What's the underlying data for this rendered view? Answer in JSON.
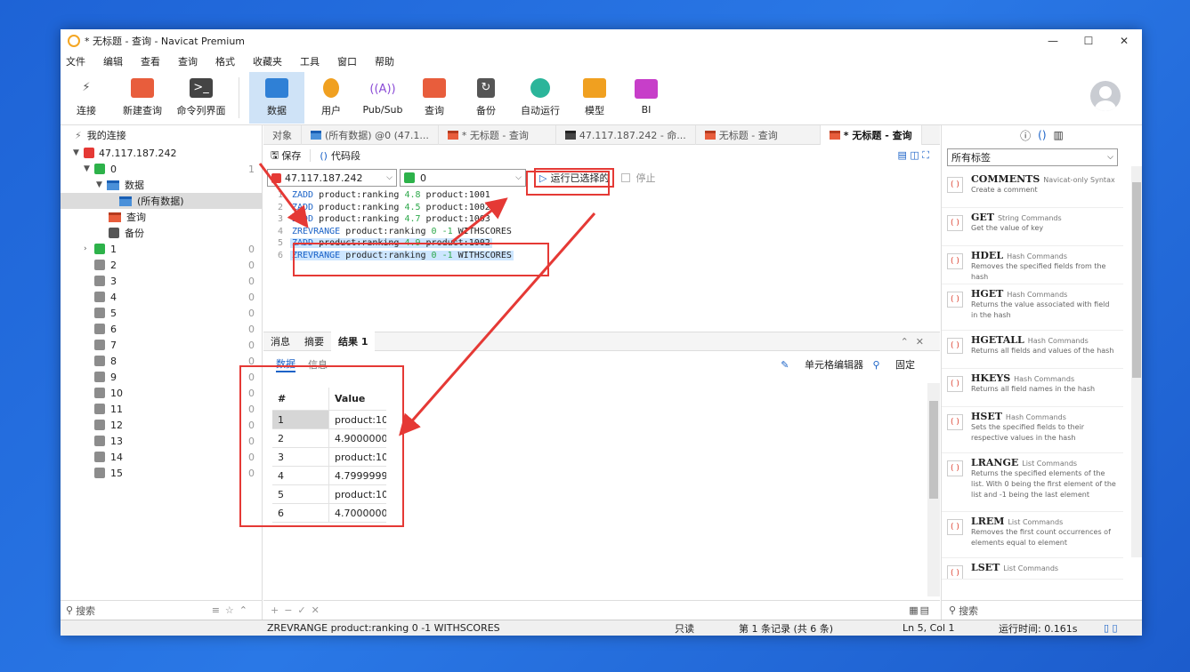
{
  "window": {
    "title": "* 无标题 - 查询 - Navicat Premium",
    "min": "—",
    "max": "☐",
    "close": "✕"
  },
  "menu": [
    "文件",
    "编辑",
    "查看",
    "查询",
    "格式",
    "收藏夹",
    "工具",
    "窗口",
    "帮助"
  ],
  "toolbar": {
    "connect": "连接",
    "new_query": "新建查询",
    "cmd": "命令列界面",
    "data": "数据",
    "user": "用户",
    "pubsub": "Pub/Sub",
    "query": "查询",
    "backup": "备份",
    "auto": "自动运行",
    "model": "模型",
    "bi": "BI"
  },
  "tree": {
    "header": "我的连接",
    "server": "47.117.187.242",
    "db0": "0",
    "db0_count": "1",
    "data_node": "数据",
    "all_data": "(所有数据)",
    "query_node": "查询",
    "backup_node": "备份",
    "dbs": [
      {
        "name": "1",
        "count": "0"
      },
      {
        "name": "2",
        "count": "0"
      },
      {
        "name": "3",
        "count": "0"
      },
      {
        "name": "4",
        "count": "0"
      },
      {
        "name": "5",
        "count": "0"
      },
      {
        "name": "6",
        "count": "0"
      },
      {
        "name": "7",
        "count": "0"
      },
      {
        "name": "8",
        "count": "0"
      },
      {
        "name": "9",
        "count": "0"
      },
      {
        "name": "10",
        "count": "0"
      },
      {
        "name": "11",
        "count": "0"
      },
      {
        "name": "12",
        "count": "0"
      },
      {
        "name": "13",
        "count": "0"
      },
      {
        "name": "14",
        "count": "0"
      },
      {
        "name": "15",
        "count": "0"
      }
    ],
    "search": "搜索"
  },
  "tabs": {
    "objects": "对象",
    "t1": "(所有数据) @0 (47.1...",
    "t2": "* 无标题 - 查询",
    "t3": "47.117.187.242 - 命...",
    "t4": "无标题 - 查询",
    "t5": "* 无标题 - 查询"
  },
  "qtool": {
    "save": "保存",
    "snippet": "代码段"
  },
  "selectors": {
    "conn": "47.117.187.242",
    "db": "0",
    "run": "运行已选择的",
    "stop": "停止"
  },
  "editor": {
    "lines": [
      {
        "no": "1",
        "cmd": "ZADD",
        "key": " product:ranking ",
        "num": "4.8",
        "rest": " product:1001",
        "hl": false
      },
      {
        "no": "2",
        "cmd": "ZADD",
        "key": " product:ranking ",
        "num": "4.5",
        "rest": " product:1002",
        "hl": false
      },
      {
        "no": "3",
        "cmd": "ZADD",
        "key": " product:ranking ",
        "num": "4.7",
        "rest": " product:1003",
        "hl": false
      },
      {
        "no": "4",
        "cmd": "ZREVRANGE",
        "key": " product:ranking ",
        "num": "0 -1",
        "rest": " WITHSCORES",
        "hl": false
      },
      {
        "no": "5",
        "cmd": "ZADD",
        "key": " product:ranking ",
        "num": "4.9",
        "rest": " product:1002",
        "hl": true
      },
      {
        "no": "6",
        "cmd": "ZREVRANGE",
        "key": " product:ranking ",
        "num": "0 -1",
        "rest": " WITHSCORES",
        "hl": true
      }
    ]
  },
  "result_tabs": {
    "msg": "消息",
    "summary": "摘要",
    "result": "结果 1",
    "data": "数据",
    "info": "信息",
    "cell_editor": "单元格编辑器",
    "pin": "固定"
  },
  "grid": {
    "headers": [
      "#",
      "Value"
    ],
    "rows": [
      {
        "n": "1",
        "v": "product:10"
      },
      {
        "n": "2",
        "v": "4.90000000"
      },
      {
        "n": "3",
        "v": "product:10"
      },
      {
        "n": "4",
        "v": "4.79999999"
      },
      {
        "n": "5",
        "v": "product:10"
      },
      {
        "n": "6",
        "v": "4.70000000"
      }
    ]
  },
  "right": {
    "tag_filter": "所有标签",
    "snippets": [
      {
        "title": "COMMENTS",
        "cat": "Navicat-only Syntax",
        "desc": "Create a comment"
      },
      {
        "title": "GET",
        "cat": "String Commands",
        "desc": "Get the value of key"
      },
      {
        "title": "HDEL",
        "cat": "Hash Commands",
        "desc": "Removes the specified fields from the hash"
      },
      {
        "title": "HGET",
        "cat": "Hash Commands",
        "desc": "Returns the value associated with field in the hash"
      },
      {
        "title": "HGETALL",
        "cat": "Hash Commands",
        "desc": "Returns all fields and values of the hash"
      },
      {
        "title": "HKEYS",
        "cat": "Hash Commands",
        "desc": "Returns all field names in the hash"
      },
      {
        "title": "HSET",
        "cat": "Hash Commands",
        "desc": "Sets the specified fields to their respective values in the hash"
      },
      {
        "title": "LRANGE",
        "cat": "List Commands",
        "desc": "Returns the specified elements of the list. With 0 being the first element of the list and -1 being the last element"
      },
      {
        "title": "LREM",
        "cat": "List Commands",
        "desc": "Removes the first count occurrences of elements equal to element"
      },
      {
        "title": "LSET",
        "cat": "List Commands",
        "desc": ""
      }
    ],
    "search": "搜索"
  },
  "status": {
    "sql": "ZREVRANGE product:ranking 0 -1 WITHSCORES",
    "mode": "只读",
    "records": "第 1 条记录 (共 6 条)",
    "pos": "Ln 5, Col 1",
    "time": "运行时间: 0.161s"
  },
  "colors": {
    "accent": "#1a62c7",
    "annotation": "#e53935",
    "background": "#1e63d6"
  }
}
